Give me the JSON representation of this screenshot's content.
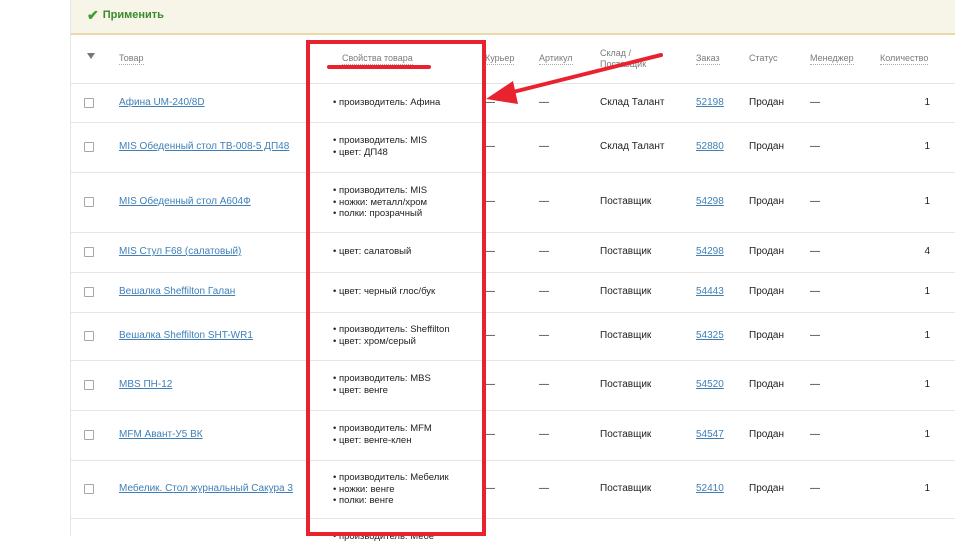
{
  "toolbar": {
    "apply_label": "Применить"
  },
  "columns": {
    "product": "Товар",
    "properties": "Свойства товара",
    "courier": "Курьер",
    "article": "Артикул",
    "warehouse": "Склад / Поставщик",
    "order": "Заказ",
    "status": "Статус",
    "manager": "Менеджер",
    "quantity": "Количество"
  },
  "rows": [
    {
      "product": "Афина UM-240/8D",
      "props": [
        "производитель: Афина"
      ],
      "courier": "—",
      "article": "—",
      "warehouse": "Склад Талант",
      "order": "52198",
      "status": "Продан",
      "manager": "—",
      "qty": "1"
    },
    {
      "product": "MIS Обеденный стол ТВ-008-5 ДП48",
      "props": [
        "производитель: MIS",
        "цвет: ДП48"
      ],
      "courier": "—",
      "article": "—",
      "warehouse": "Склад Талант",
      "order": "52880",
      "status": "Продан",
      "manager": "—",
      "qty": "1"
    },
    {
      "product": "MIS Обеденный стол А604Ф",
      "props": [
        "производитель: MIS",
        "ножки: металл/хром",
        "полки: прозрачный"
      ],
      "courier": "—",
      "article": "—",
      "warehouse": "Поставщик",
      "order": "54298",
      "status": "Продан",
      "manager": "—",
      "qty": "1"
    },
    {
      "product": "MIS Стул F68 (салатовый)",
      "props": [
        "цвет: салатовый"
      ],
      "courier": "—",
      "article": "—",
      "warehouse": "Поставщик",
      "order": "54298",
      "status": "Продан",
      "manager": "—",
      "qty": "4"
    },
    {
      "product": "Вешалка Sheffilton Галан",
      "props": [
        "цвет: черный глос/бук"
      ],
      "courier": "—",
      "article": "—",
      "warehouse": "Поставщик",
      "order": "54443",
      "status": "Продан",
      "manager": "—",
      "qty": "1"
    },
    {
      "product": "Вешалка Sheffilton SHT-WR1",
      "props": [
        "производитель: Sheffilton",
        "цвет: хром/серый"
      ],
      "courier": "—",
      "article": "—",
      "warehouse": "Поставщик",
      "order": "54325",
      "status": "Продан",
      "manager": "—",
      "qty": "1"
    },
    {
      "product": "MBS ПН-12",
      "props": [
        "производитель: MBS",
        "цвет: венге"
      ],
      "courier": "—",
      "article": "—",
      "warehouse": "Поставщик",
      "order": "54520",
      "status": "Продан",
      "manager": "—",
      "qty": "1"
    },
    {
      "product": "MFM Авант-У5 ВК",
      "props": [
        "производитель: MFM",
        "цвет: венге-клен"
      ],
      "courier": "—",
      "article": "—",
      "warehouse": "Поставщик",
      "order": "54547",
      "status": "Продан",
      "manager": "—",
      "qty": "1"
    },
    {
      "product": "Мебелик. Стол журнальный Сакура 3",
      "props": [
        "производитель: Мебелик",
        "ножки: венге",
        "полки: венге"
      ],
      "courier": "—",
      "article": "—",
      "warehouse": "Поставщик",
      "order": "52410",
      "status": "Продан",
      "manager": "—",
      "qty": "1"
    }
  ],
  "partial_next_row": {
    "props": [
      "производитель: Мебе"
    ]
  }
}
